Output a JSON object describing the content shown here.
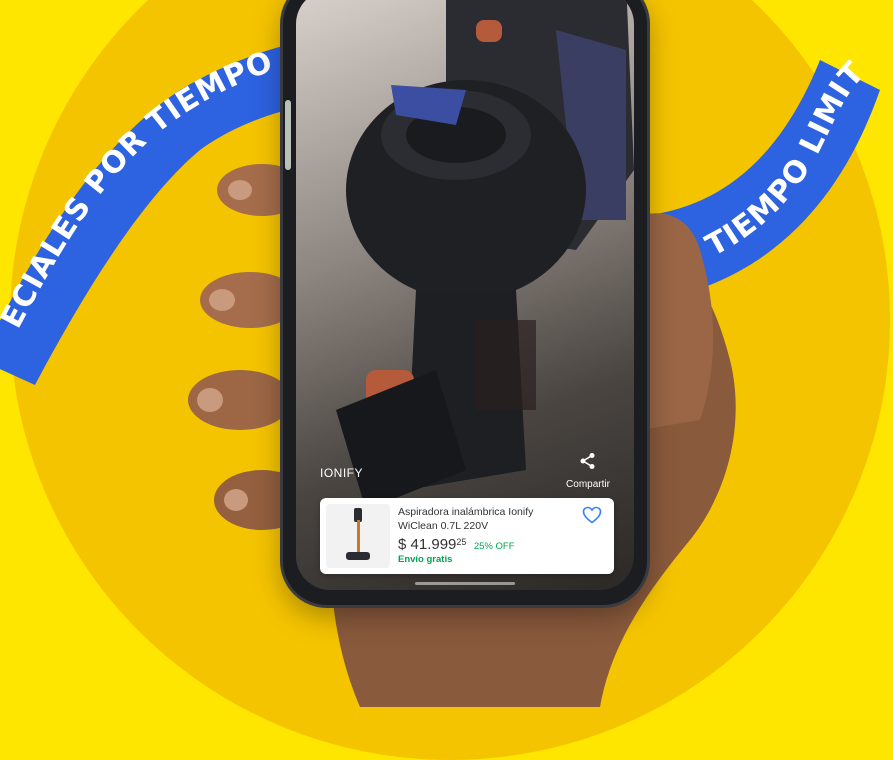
{
  "background": {
    "color": "#ffe600",
    "circle_color": "#f5c400",
    "ribbon_color": "#2d62e0",
    "ribbon_left_text": "ECIALES POR TIEMPO LIMITAD",
    "ribbon_right_text": "R TIEMPO LIMITAD"
  },
  "video": {
    "brand": "IONIFY",
    "share_label": "Compartir",
    "share_icon": "share-icon"
  },
  "product": {
    "title": "Aspiradora inalámbrica Ionify WiClean 0.7L 220V",
    "price": "$ 41.999",
    "cents": "25",
    "discount": "25% OFF",
    "shipping": "Envío gratis",
    "favorite_icon": "heart-icon",
    "accent_color": "#3483fa",
    "green_color": "#00a650"
  }
}
